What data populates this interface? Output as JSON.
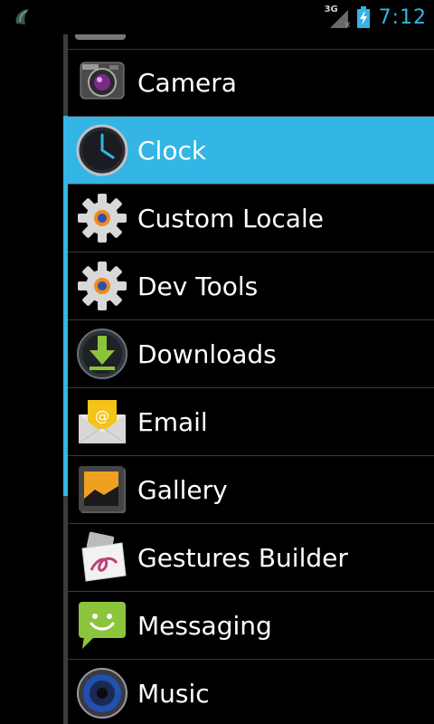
{
  "status_bar": {
    "network_type": "3G",
    "no_signal_mark": "×",
    "time": "7:12",
    "time_color": "#33b5e5",
    "app_icon": "app-launcher-icon",
    "battery_icon": "battery-charging-icon"
  },
  "theme": {
    "accent": "#33b5e5",
    "background": "#000000",
    "divider": "#3a3a3a"
  },
  "app_list": {
    "items": [
      {
        "label": "Camera",
        "icon": "camera-icon",
        "selected": false
      },
      {
        "label": "Clock",
        "icon": "clock-icon",
        "selected": true
      },
      {
        "label": "Custom Locale",
        "icon": "gear-icon",
        "selected": false
      },
      {
        "label": "Dev Tools",
        "icon": "gear-icon",
        "selected": false
      },
      {
        "label": "Downloads",
        "icon": "download-icon",
        "selected": false
      },
      {
        "label": "Email",
        "icon": "email-icon",
        "selected": false
      },
      {
        "label": "Gallery",
        "icon": "gallery-icon",
        "selected": false
      },
      {
        "label": "Gestures Builder",
        "icon": "gestures-icon",
        "selected": false
      },
      {
        "label": "Messaging",
        "icon": "messaging-icon",
        "selected": false
      },
      {
        "label": "Music",
        "icon": "music-icon",
        "selected": false
      }
    ]
  }
}
